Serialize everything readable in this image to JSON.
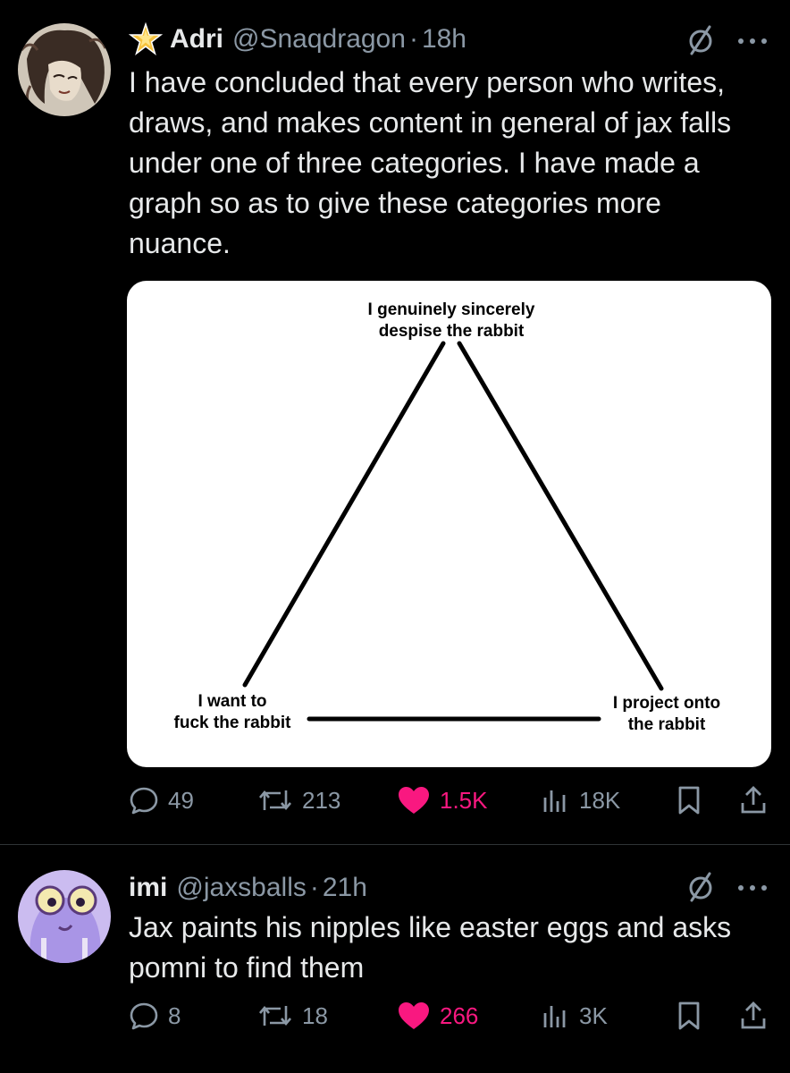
{
  "posts": [
    {
      "author_name": "Adri",
      "handle": "@Snaqdragon",
      "separator": "·",
      "time": "18h",
      "text": "I have concluded that every person who writes, draws, and makes content in general of jax falls under one of three categories. I have made a graph so as to give these categories more nuance.",
      "media": {
        "top_label_line1": "I genuinely sincerely",
        "top_label_line2": "despise the rabbit",
        "left_label_line1": "I want to",
        "left_label_line2": "fuck the rabbit",
        "right_label_line1": "I project onto",
        "right_label_line2": "the rabbit"
      },
      "stats": {
        "replies": "49",
        "reposts": "213",
        "likes": "1.5K",
        "views": "18K"
      },
      "like_color": "#f91880"
    },
    {
      "author_name": "imi",
      "handle": "@jaxsballs",
      "separator": "·",
      "time": "21h",
      "text": "Jax paints his nipples like easter eggs and asks pomni to find them",
      "stats": {
        "replies": "8",
        "reposts": "18",
        "likes": "266",
        "views": "3K"
      },
      "like_color": "#f91880"
    }
  ],
  "icons": {
    "badge": "star-badge-icon",
    "grok": "slashed-circle-icon",
    "more": "more-dots-icon",
    "reply": "reply-bubble-icon",
    "repost": "repost-arrows-icon",
    "like": "heart-icon",
    "views": "views-bars-icon",
    "bookmark": "bookmark-icon",
    "share": "share-icon"
  }
}
